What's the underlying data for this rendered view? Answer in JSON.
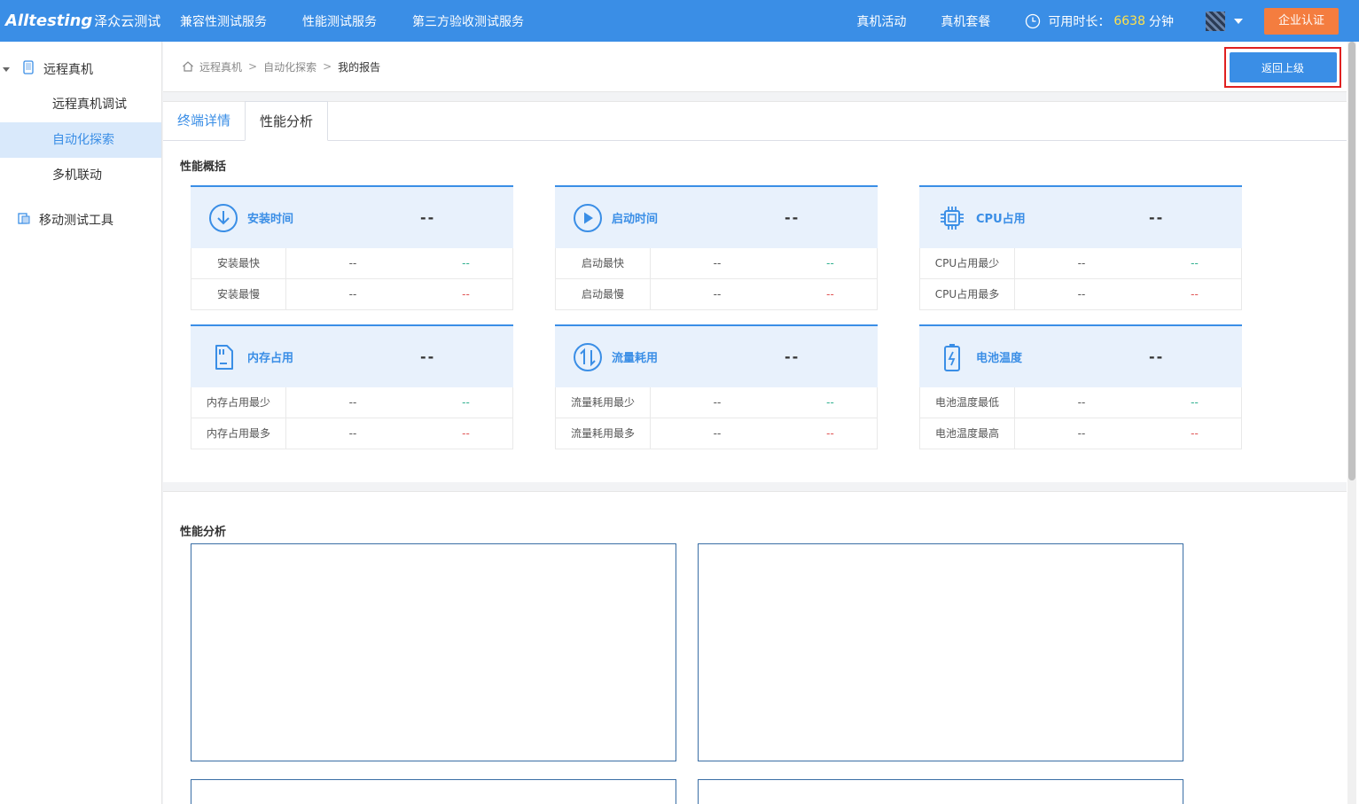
{
  "header": {
    "logo_text": "Alltesting",
    "logo_cn": "泽众云测试",
    "nav": [
      "兼容性测试服务",
      "性能测试服务",
      "第三方验收测试服务"
    ],
    "right_links": [
      "真机活动",
      "真机套餐"
    ],
    "time_label": "可用时长：",
    "time_value": "6638",
    "time_unit": "分钟",
    "enterprise_button": "企业认证"
  },
  "sidebar": {
    "group1": "远程真机",
    "items": [
      "远程真机调试",
      "自动化探索",
      "多机联动"
    ],
    "active_item": "自动化探索",
    "group2": "移动测试工具"
  },
  "breadcrumb": [
    "远程真机",
    "自动化探索",
    "我的报告"
  ],
  "back_button": "返回上级",
  "tabs": [
    "终端详情",
    "性能分析"
  ],
  "active_tab": "性能分析",
  "overview": {
    "title": "性能概括",
    "cards": [
      {
        "title": "安装时间",
        "value": "--",
        "icon": "download-icon",
        "rows": [
          {
            "label": "安装最快",
            "v1": "--",
            "v2": "--",
            "tone": "green"
          },
          {
            "label": "安装最慢",
            "v1": "--",
            "v2": "--",
            "tone": "red"
          }
        ]
      },
      {
        "title": "启动时间",
        "value": "--",
        "icon": "play-icon",
        "rows": [
          {
            "label": "启动最快",
            "v1": "--",
            "v2": "--",
            "tone": "green"
          },
          {
            "label": "启动最慢",
            "v1": "--",
            "v2": "--",
            "tone": "red"
          }
        ]
      },
      {
        "title": "CPU占用",
        "value": "--",
        "icon": "cpu-icon",
        "rows": [
          {
            "label": "CPU占用最少",
            "v1": "--",
            "v2": "--",
            "tone": "green"
          },
          {
            "label": "CPU占用最多",
            "v1": "--",
            "v2": "--",
            "tone": "red"
          }
        ]
      },
      {
        "title": "内存占用",
        "value": "--",
        "icon": "memory-card-icon",
        "rows": [
          {
            "label": "内存占用最少",
            "v1": "--",
            "v2": "--",
            "tone": "green"
          },
          {
            "label": "内存占用最多",
            "v1": "--",
            "v2": "--",
            "tone": "red"
          }
        ]
      },
      {
        "title": "流量耗用",
        "value": "--",
        "icon": "traffic-arrows-icon",
        "rows": [
          {
            "label": "流量耗用最少",
            "v1": "--",
            "v2": "--",
            "tone": "green"
          },
          {
            "label": "流量耗用最多",
            "v1": "--",
            "v2": "--",
            "tone": "red"
          }
        ]
      },
      {
        "title": "电池温度",
        "value": "--",
        "icon": "battery-icon",
        "rows": [
          {
            "label": "电池温度最低",
            "v1": "--",
            "v2": "--",
            "tone": "green"
          },
          {
            "label": "电池温度最高",
            "v1": "--",
            "v2": "--",
            "tone": "red"
          }
        ]
      }
    ]
  },
  "analysis": {
    "title": "性能分析"
  },
  "colors": {
    "primary": "#3a8ee6",
    "enterprise": "#f47d3f",
    "highlight": "#e02020",
    "good": "#30b08f",
    "bad": "#e05454"
  }
}
